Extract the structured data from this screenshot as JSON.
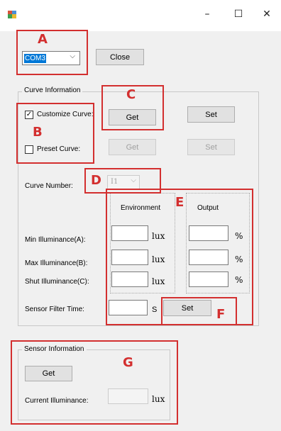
{
  "window": {
    "minimize_glyph": "–",
    "maximize_glyph": "☐",
    "close_glyph": "✕"
  },
  "port": {
    "selected": "COM3",
    "close_label": "Close"
  },
  "curve_info": {
    "title": "Curve Information",
    "customize_label": "Customize Curve:",
    "customize_checked": true,
    "preset_label": "Preset Curve:",
    "preset_checked": false,
    "get_label": "Get",
    "set_label": "Set",
    "preset_get_label": "Get",
    "preset_set_label": "Set",
    "curve_number_label": "Curve Number:",
    "curve_number_value": "I1",
    "environment_header": "Environment",
    "output_header": "Output",
    "rows": [
      {
        "label": "Min Illuminance(A):",
        "env_unit": "lux",
        "out_unit": "%"
      },
      {
        "label": "Max Illuminance(B):",
        "env_unit": "lux",
        "out_unit": "%"
      },
      {
        "label": "Shut Illuminance(C):",
        "env_unit": "lux",
        "out_unit": "%"
      }
    ],
    "filter_label": "Sensor Filter Time:",
    "filter_unit": "S",
    "filter_set_label": "Set"
  },
  "sensor_info": {
    "title": "Sensor Information",
    "get_label": "Get",
    "current_label": "Current Illuminance:",
    "current_unit": "lux"
  },
  "annotations": {
    "A": "A",
    "B": "B",
    "C": "C",
    "D": "D",
    "E": "E",
    "F": "F",
    "G": "G",
    "color": "#d32f2f"
  }
}
